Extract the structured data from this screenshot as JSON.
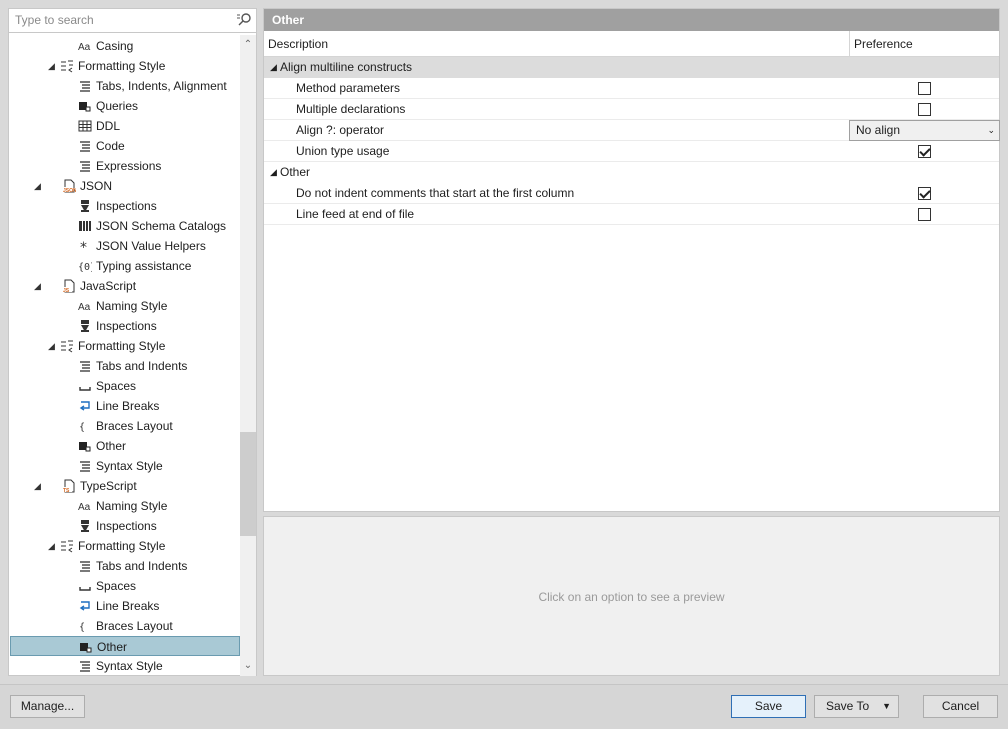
{
  "search": {
    "placeholder": "Type to search"
  },
  "tree": [
    {
      "label": "Casing",
      "icon": "casing-icon"
    },
    {
      "label": "Formatting Style",
      "icon": "formatting-icon",
      "expanded": true
    },
    {
      "label": "Tabs, Indents, Alignment",
      "icon": "tabs-icon"
    },
    {
      "label": "Queries",
      "icon": "other-icon"
    },
    {
      "label": "DDL",
      "icon": "table-icon"
    },
    {
      "label": "Code",
      "icon": "code-icon"
    },
    {
      "label": "Expressions",
      "icon": "tabs-icon"
    },
    {
      "label": "JSON",
      "icon": "json-file-icon",
      "expanded": true
    },
    {
      "label": "Inspections",
      "icon": "inspections-icon"
    },
    {
      "label": "JSON Schema Catalogs",
      "icon": "catalog-icon"
    },
    {
      "label": "JSON Value Helpers",
      "icon": "asterisk-icon"
    },
    {
      "label": "Typing assistance",
      "icon": "typing-icon"
    },
    {
      "label": "JavaScript",
      "icon": "js-file-icon",
      "expanded": true
    },
    {
      "label": "Naming Style",
      "icon": "casing-icon"
    },
    {
      "label": "Inspections",
      "icon": "inspections-icon"
    },
    {
      "label": "Formatting Style",
      "icon": "formatting-icon",
      "expanded": true
    },
    {
      "label": "Tabs and Indents",
      "icon": "tabs-icon"
    },
    {
      "label": "Spaces",
      "icon": "spaces-icon"
    },
    {
      "label": "Line Breaks",
      "icon": "linebreak-icon"
    },
    {
      "label": "Braces Layout",
      "icon": "braces-icon"
    },
    {
      "label": "Other",
      "icon": "other-icon"
    },
    {
      "label": "Syntax Style",
      "icon": "syntax-icon"
    },
    {
      "label": "TypeScript",
      "icon": "ts-file-icon",
      "expanded": true
    },
    {
      "label": "Naming Style",
      "icon": "casing-icon"
    },
    {
      "label": "Inspections",
      "icon": "inspections-icon"
    },
    {
      "label": "Formatting Style",
      "icon": "formatting-icon",
      "expanded": true
    },
    {
      "label": "Tabs and Indents",
      "icon": "tabs-icon"
    },
    {
      "label": "Spaces",
      "icon": "spaces-icon"
    },
    {
      "label": "Line Breaks",
      "icon": "linebreak-icon"
    },
    {
      "label": "Braces Layout",
      "icon": "braces-icon"
    },
    {
      "label": "Other",
      "icon": "other-icon",
      "selected": true
    },
    {
      "label": "Syntax Style",
      "icon": "syntax-icon"
    }
  ],
  "panel": {
    "title": "Other",
    "col_description": "Description",
    "col_preference": "Preference",
    "groups": [
      {
        "label": "Align multiline constructs",
        "options": [
          {
            "label": "Method parameters",
            "type": "checkbox",
            "checked": false
          },
          {
            "label": "Multiple declarations",
            "type": "checkbox",
            "checked": false
          },
          {
            "label": "Align ?: operator",
            "type": "select",
            "value": "No align"
          },
          {
            "label": "Union type usage",
            "type": "checkbox",
            "checked": true
          }
        ]
      },
      {
        "label": "Other",
        "options": [
          {
            "label": "Do not indent comments that start at the first column",
            "type": "checkbox",
            "checked": true
          },
          {
            "label": "Line feed at end of file",
            "type": "checkbox",
            "checked": false
          }
        ]
      }
    ]
  },
  "preview": {
    "message": "Click on an option to see a preview"
  },
  "buttons": {
    "manage": "Manage...",
    "save": "Save",
    "save_to": "Save To",
    "cancel": "Cancel"
  },
  "colors": {
    "selection": "#a9c9d5",
    "header": "#a0a0a0",
    "accent": "#2f6fb5"
  }
}
